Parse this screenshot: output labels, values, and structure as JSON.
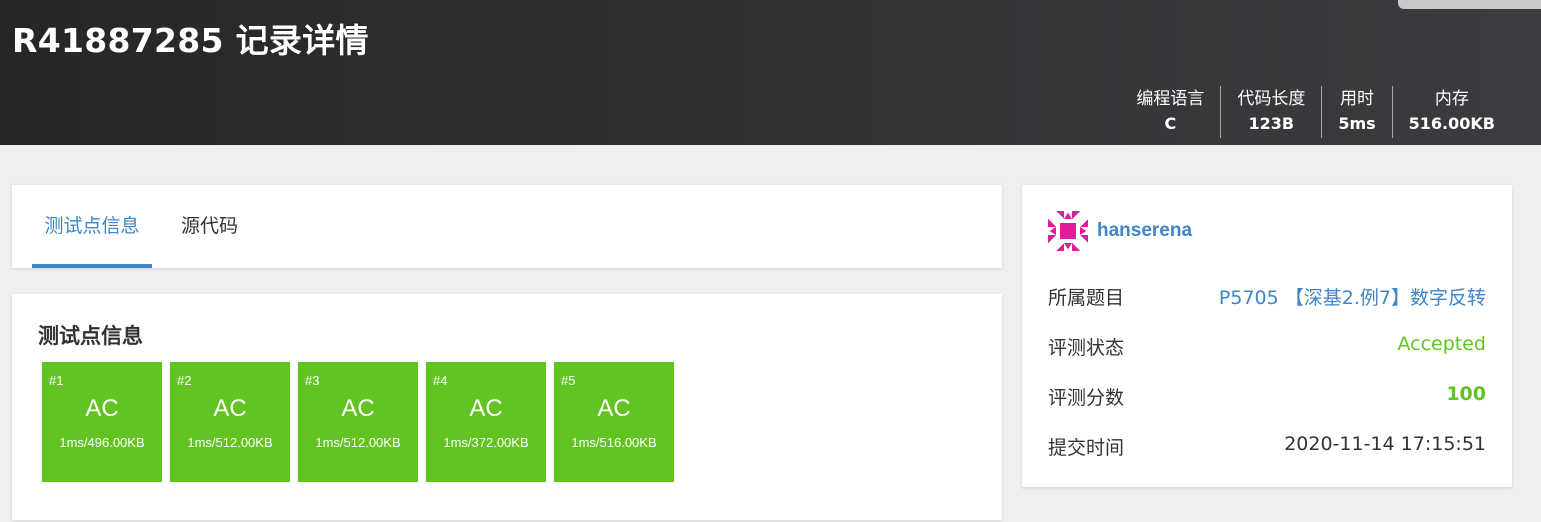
{
  "header": {
    "title": "R41887285 记录详情",
    "stats": [
      {
        "label": "编程语言",
        "value": "C"
      },
      {
        "label": "代码长度",
        "value": "123B"
      },
      {
        "label": "用时",
        "value": "5ms"
      },
      {
        "label": "内存",
        "value": "516.00KB"
      }
    ]
  },
  "tabs": [
    {
      "label": "测试点信息",
      "active": true
    },
    {
      "label": "源代码",
      "active": false
    }
  ],
  "testcases": {
    "title": "测试点信息",
    "status_color": "#62c422",
    "items": [
      {
        "num": "#1",
        "status": "AC",
        "detail": "1ms/496.00KB"
      },
      {
        "num": "#2",
        "status": "AC",
        "detail": "1ms/512.00KB"
      },
      {
        "num": "#3",
        "status": "AC",
        "detail": "1ms/512.00KB"
      },
      {
        "num": "#4",
        "status": "AC",
        "detail": "1ms/372.00KB"
      },
      {
        "num": "#5",
        "status": "AC",
        "detail": "1ms/516.00KB"
      }
    ]
  },
  "sidebar": {
    "username": "hanserena",
    "avatar_icon": "identicon-avatar",
    "rows": [
      {
        "label": "所属题目",
        "value": "P5705 【深基2.例7】数字反转"
      },
      {
        "label": "评测状态",
        "value": "Accepted"
      },
      {
        "label": "评测分数",
        "value": "100"
      },
      {
        "label": "提交时间",
        "value": "2020-11-14 17:15:51"
      }
    ]
  },
  "colors": {
    "accent": "#3e86c8",
    "success": "#62c422",
    "header_bg": "#2d2e30"
  }
}
